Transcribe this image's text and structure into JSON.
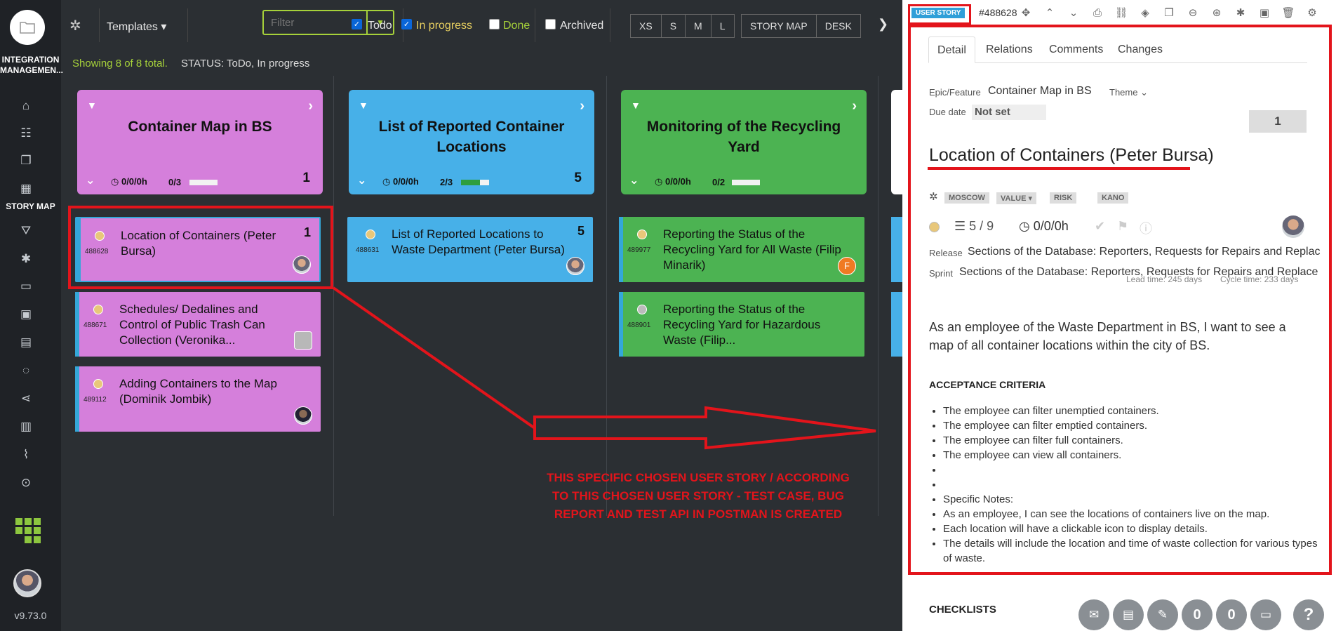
{
  "sidebar": {
    "app_name_line1": "INTEGRATION",
    "app_name_line2": "MANAGEMEN...",
    "active_label": "STORY MAP",
    "version": "v9.73.0"
  },
  "toolbar": {
    "templates_label": "Templates",
    "filter_placeholder": "Filter",
    "todo_label": "Todo",
    "inprogress_label": "In progress",
    "done_label": "Done",
    "archived_label": "Archived",
    "sizes": [
      "XS",
      "S",
      "M",
      "L"
    ],
    "views": [
      "STORY MAP",
      "DESK"
    ]
  },
  "status": {
    "showing": "Showing 8 of 8 total.",
    "filter": "STATUS: ToDo, In progress"
  },
  "epics": [
    {
      "title": "Container Map in BS",
      "time": "0/0/0h",
      "frac": "0/3",
      "progress": 0,
      "count": "1",
      "color": "#d57fdb"
    },
    {
      "title": "List of Reported Container Locations",
      "time": "0/0/0h",
      "frac": "2/3",
      "progress": 0.67,
      "count": "5",
      "color": "#47b0e8"
    },
    {
      "title": "Monitoring of the Recycling Yard",
      "time": "0/0/0h",
      "frac": "0/2",
      "progress": 0,
      "count": "",
      "color": "#4cb352"
    }
  ],
  "stories": [
    {
      "id": "488628",
      "text": "Location of Containers (Peter Bursa)",
      "num": "1"
    },
    {
      "id": "488671",
      "text": "Schedules/ Dedalines and Control of Public Trash Can Collection (Veronika...",
      "num": ""
    },
    {
      "id": "489112",
      "text": "Adding Containers to the Map (Dominik Jombik)",
      "num": ""
    },
    {
      "id": "488631",
      "text": "List of Reported Locations to Waste Department (Peter Bursa)",
      "num": "5"
    },
    {
      "id": "489977",
      "text": "Reporting the Status of the Recycling Yard for All Waste (Filip Minarik)",
      "num": "",
      "initial": "F"
    },
    {
      "id": "488901",
      "text": "Reporting the Status of the Recycling Yard for Hazardous Waste (Filip...",
      "num": ""
    }
  ],
  "annotation": {
    "line1": "THIS SPECIFIC CHOSEN USER STORY / ACCORDING",
    "line2": "TO THIS CHOSEN USER STORY - TEST CASE, BUG",
    "line3": "REPORT AND TEST API IN POSTMAN IS CREATED"
  },
  "panel": {
    "type_tag": "USER STORY",
    "id": "#488628",
    "tabs": [
      "Detail",
      "Relations",
      "Comments",
      "Changes"
    ],
    "epic_label": "Epic/Feature",
    "epic_value": "Container Map in BS",
    "theme_label": "Theme",
    "due_label": "Due date",
    "due_value": "Not set",
    "estimate": "1",
    "title": "Location of Containers (Peter Bursa)",
    "pills": [
      "MOSCOW",
      "VALUE",
      "RISK",
      "KANO"
    ],
    "tasks": "5 / 9",
    "time": "0/0/0h",
    "release_label": "Release",
    "release_value": "Sections of the Database: Reporters, Requests for Repairs and Replac",
    "sprint_label": "Sprint",
    "sprint_value": "Sections of the Database: Reporters, Requests for Repairs and Replace",
    "lead_time": "Lead time: 245 days",
    "cycle_time": "Cycle time: 233 days",
    "description": "As an employee of the Waste Department in BS, I want to see a map of all container locations within the city of BS.",
    "criteria_title": "ACCEPTANCE CRITERIA",
    "criteria": [
      "The employee can filter unemptied containers.",
      "The employee can filter emptied containers.",
      "The employee can filter full containers.",
      "The employee can view all containers.",
      "",
      "",
      "Specific Notes:",
      "As an employee, I can see the locations of containers live on the map.",
      "Each location will have a clickable icon to display details.",
      "The details will include the location and time of waste collection for various types of waste."
    ],
    "checklists": "CHECKLISTS",
    "counters": [
      "0",
      "0"
    ]
  }
}
